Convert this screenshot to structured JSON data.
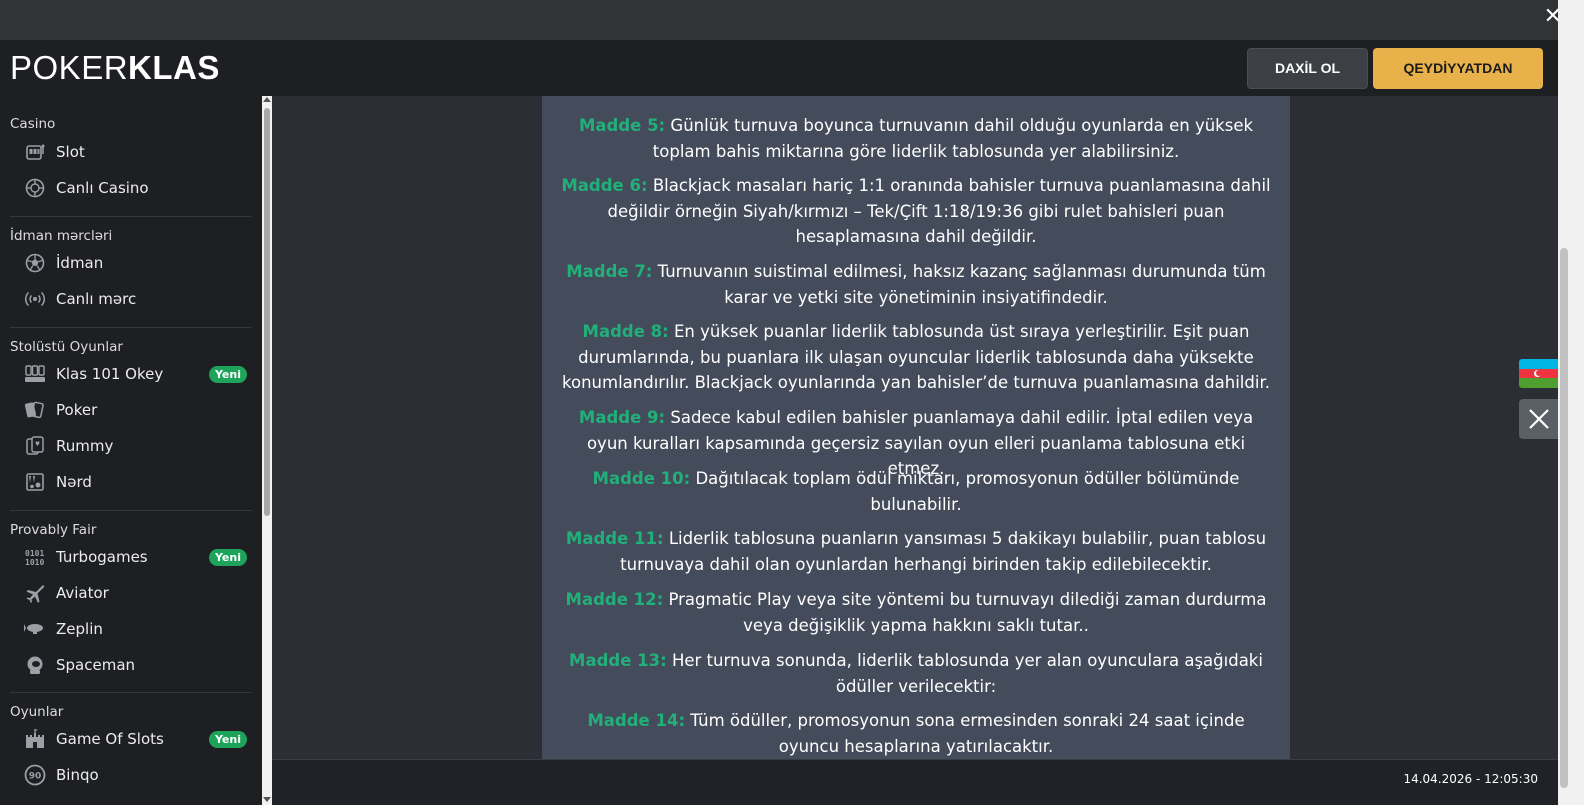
{
  "header": {
    "logo_light": "POKER",
    "logo_bold": "KLAS",
    "login_label": "DAXİL OL",
    "register_label": "QEYDİYYATDAN"
  },
  "sidebar": {
    "sections": [
      {
        "title": "Casino",
        "items": [
          {
            "label": "Slot",
            "icon": "slot-machine-icon"
          },
          {
            "label": "Canlı Casino",
            "icon": "casino-chip-icon"
          }
        ]
      },
      {
        "title": "İdman mərcləri",
        "items": [
          {
            "label": "İdman",
            "icon": "soccer-ball-icon"
          },
          {
            "label": "Canlı mərc",
            "icon": "live-broadcast-icon"
          }
        ]
      },
      {
        "title": "Stolüstü Oyunlar",
        "items": [
          {
            "label": "Klas 101 Okey",
            "icon": "okey-tiles-icon",
            "badge": "Yeni"
          },
          {
            "label": "Poker",
            "icon": "cards-icon"
          },
          {
            "label": "Rummy",
            "icon": "rummy-cards-icon"
          },
          {
            "label": "Nərd",
            "icon": "backgammon-icon"
          }
        ]
      },
      {
        "title": "Provably Fair",
        "items": [
          {
            "label": "Turbogames",
            "icon": "binary-digits-icon",
            "badge": "Yeni"
          },
          {
            "label": "Aviator",
            "icon": "airplane-icon"
          },
          {
            "label": "Zeplin",
            "icon": "zeppelin-icon"
          },
          {
            "label": "Spaceman",
            "icon": "astronaut-icon"
          }
        ]
      },
      {
        "title": "Oyunlar",
        "items": [
          {
            "label": "Game Of Slots",
            "icon": "castle-icon",
            "badge": "Yeni"
          },
          {
            "label": "Binqo",
            "icon": "bingo-ball-icon"
          }
        ]
      }
    ]
  },
  "content": {
    "partial_top": "...",
    "rules": [
      {
        "label": "Madde 5:",
        "text": "Günlük turnuva boyunca turnuvanın dahil olduğu oyunlarda en yüksek toplam bahis miktarına göre liderlik tablosunda yer alabilirsiniz."
      },
      {
        "label": "Madde 6:",
        "text": "Blackjack masaları hariç 1:1 oranında bahisler turnuva puanlamasına dahil değildir örneğin Siyah/kırmızı – Tek/Çift 1:18/19:36 gibi rulet bahisleri puan hesaplamasına dahil değildir."
      },
      {
        "label": "Madde 7:",
        "text": "Turnuvanın suistimal edilmesi, haksız kazanç sağlanması durumunda tüm karar ve yetki site yönetiminin insiyatifindedir."
      },
      {
        "label": "Madde 8:",
        "text": "En yüksek puanlar liderlik tablosunda üst sıraya yerleştirilir. Eşit puan durumlarında, bu puanlara ilk ulaşan oyuncular liderlik tablosunda daha yüksekte konumlandırılır. Blackjack oyunlarında yan bahisler’de turnuva puanlamasına dahildir."
      },
      {
        "label": "Madde 9:",
        "text": "Sadece kabul edilen bahisler puanlamaya dahil edilir. İptal edilen veya oyun kuralları kapsamında geçersiz sayılan oyun elleri puanlama tablosuna etki etmez."
      },
      {
        "label": "Madde 10:",
        "text": "Dağıtılacak toplam ödül miktarı, promosyonun ödüller bölümünde bulunabilir."
      },
      {
        "label": "Madde 11:",
        "text": "Liderlik tablosuna puanların yansıması 5 dakikayı bulabilir, puan tablosu turnuvaya dahil olan oyunlardan herhangi birinden takip edilebilecektir."
      },
      {
        "label": "Madde 12:",
        "text": "Pragmatic Play veya site yöntemi bu turnuvayı dilediği zaman durdurma veya değişiklik yapma hakkını saklı tutar.."
      },
      {
        "label": "Madde 13:",
        "text": "Her turnuva sonunda, liderlik tablosunda yer alan oyunculara aşağıdaki ödüller verilecektir:"
      },
      {
        "label": "Madde 14:",
        "text": "Tüm ödüller, promosyonun sona ermesinden sonraki 24 saat içinde oyuncu hesaplarına yatırılacaktır."
      }
    ]
  },
  "footer": {
    "datetime": "14.04.2026 - 12:05:30"
  },
  "floating": {
    "flag_icon": "azerbaijan-flag-icon",
    "close_icon": "close-icon"
  },
  "colors": {
    "accent": "#e9b14a",
    "rule_label": "#21b07a",
    "badge": "#1ea35a",
    "content_bg": "#444b5a"
  }
}
